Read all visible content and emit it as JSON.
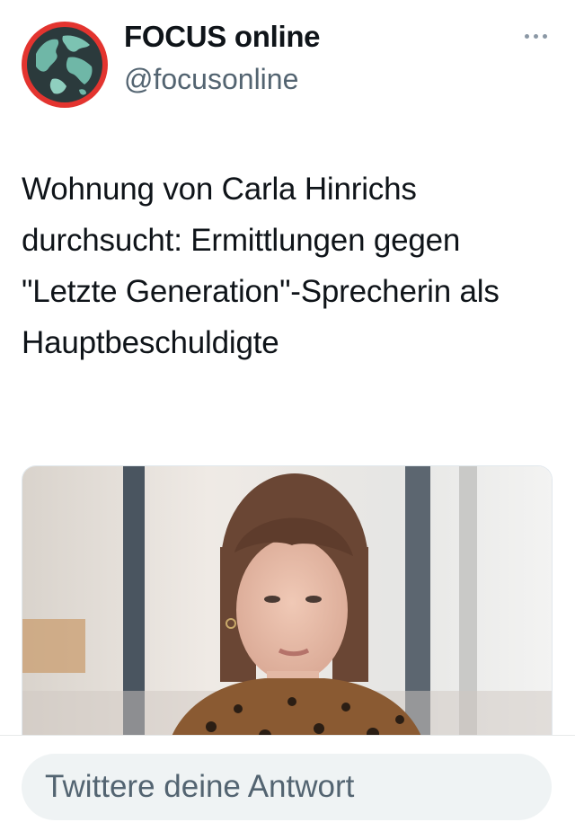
{
  "account": {
    "display_name": "FOCUS online",
    "handle": "@focusonline",
    "avatar_icon": "globe-icon"
  },
  "more_icon": "more-dots-icon",
  "tweet": {
    "text": "Wohnung von Carla Hinrichs durchsucht: Ermittlungen gegen \"Letzte Generation\"-Sprecherin als Hauptbeschuldigte"
  },
  "reply": {
    "placeholder": "Twittere deine Antwort"
  },
  "colors": {
    "avatar_ring": "#e3342f",
    "globe_water": "#2b3a3c",
    "globe_land": "#6fb7a7",
    "secondary_text": "#536471",
    "reply_background": "#eff3f4"
  }
}
